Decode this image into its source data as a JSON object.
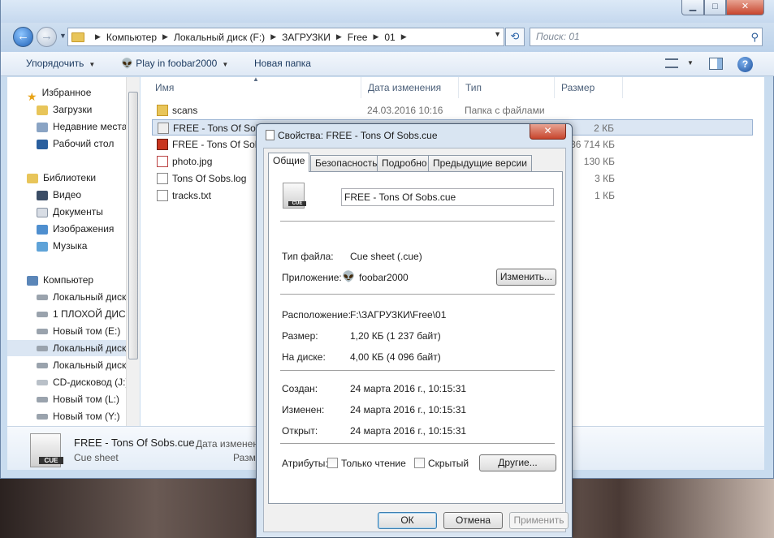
{
  "explorer": {
    "breadcrumbs": [
      "Компьютер",
      "Локальный диск (F:)",
      "ЗАГРУЗКИ",
      "Free",
      "01"
    ],
    "search_placeholder": "Поиск: 01",
    "toolbar": {
      "organize": "Упорядочить",
      "play": "Play in foobar2000",
      "new_folder": "Новая папка"
    },
    "nav": {
      "favorites": "Избранное",
      "downloads": "Загрузки",
      "recent": "Недавние места",
      "desktop": "Рабочий стол",
      "libraries": "Библиотеки",
      "video": "Видео",
      "documents": "Документы",
      "images": "Изображения",
      "music": "Музыка",
      "computer": "Компьютер",
      "drives": [
        "Локальный диск",
        "1 ПЛОХОЙ ДИС",
        "Новый том (E:)",
        "Локальный диск",
        "Локальный диск",
        "CD-дисковод (J:)",
        "Новый том (L:)",
        "Новый том (Y:)"
      ]
    },
    "columns": {
      "name": "Имя",
      "date": "Дата изменения",
      "type": "Тип",
      "size": "Размер"
    },
    "files": [
      {
        "name": "scans",
        "date": "24.03.2016 10:16",
        "type": "Папка с файлами",
        "size": "",
        "icon": "folder-icon"
      },
      {
        "name": "FREE - Tons Of Sobs.cue",
        "date": "",
        "type": "",
        "size": "2 КБ",
        "icon": "cue-file-icon"
      },
      {
        "name": "FREE - Tons Of Sobs",
        "date": "",
        "type": "",
        "size": "136 714 КБ",
        "icon": "foobar-file-icon"
      },
      {
        "name": "photo.jpg",
        "date": "",
        "type": "",
        "size": "130 КБ",
        "icon": "image-file-icon"
      },
      {
        "name": "Tons Of Sobs.log",
        "date": "",
        "type": "",
        "size": "3 КБ",
        "icon": "text-file-icon"
      },
      {
        "name": "tracks.txt",
        "date": "",
        "type": "",
        "size": "1 КБ",
        "icon": "text-file-icon"
      }
    ],
    "details": {
      "name": "FREE - Tons Of Sobs.cue",
      "type": "Cue sheet",
      "date_label": "Дата изменен",
      "size_label": "Разм"
    }
  },
  "dialog": {
    "title": "Свойства: FREE - Tons Of Sobs.cue",
    "tabs": [
      "Общие",
      "Безопасность",
      "Подробно",
      "Предыдущие версии"
    ],
    "filename": "FREE - Tons Of Sobs.cue",
    "file_type_label": "Тип файла:",
    "file_type_value": "Cue sheet (.cue)",
    "app_label": "Приложение:",
    "app_value": "foobar2000",
    "change_button": "Изменить...",
    "location_label": "Расположение:",
    "location_value": "F:\\ЗАГРУЗКИ\\Free\\01",
    "size_label": "Размер:",
    "size_value": "1,20 КБ (1 237 байт)",
    "disk_label": "На диске:",
    "disk_value": "4,00 КБ (4 096 байт)",
    "created_label": "Создан:",
    "created_value": "24 марта 2016 г., 10:15:31",
    "modified_label": "Изменен:",
    "modified_value": "24 марта 2016 г., 10:15:31",
    "opened_label": "Открыт:",
    "opened_value": "24 марта 2016 г., 10:15:31",
    "attributes_label": "Атрибуты:",
    "readonly_label": "Только чтение",
    "hidden_label": "Скрытый",
    "other_button": "Другие...",
    "ok_button": "ОК",
    "cancel_button": "Отмена",
    "apply_button": "Применить"
  }
}
